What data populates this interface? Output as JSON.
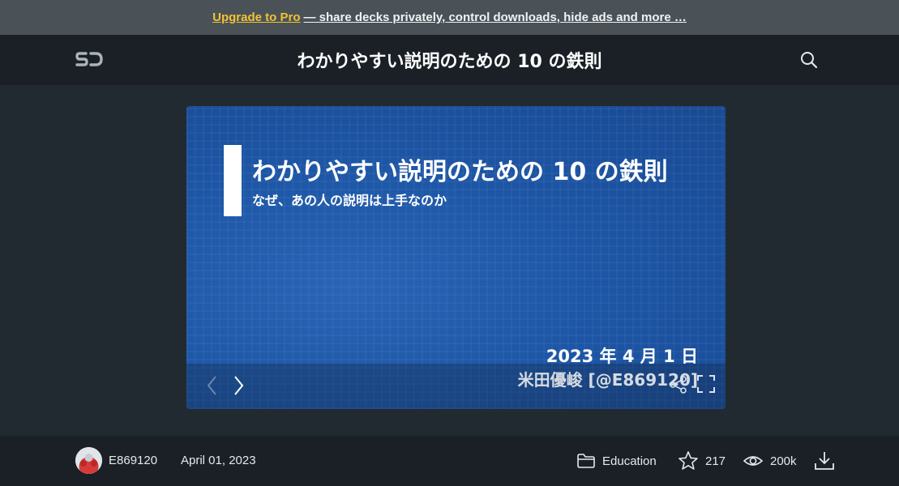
{
  "promo": {
    "link_label": "Upgrade to Pro",
    "text": "— share decks privately, control downloads, hide ads and more …"
  },
  "header": {
    "logo_text": "SD",
    "title": "わかりやすい説明のための 10 の鉄則",
    "search_icon": "search-icon"
  },
  "slide": {
    "title": "わかりやすい説明のための 10 の鉄則",
    "subtitle": "なぜ、あの人の説明は上手なのか",
    "date": "2023 年 4 月 1 日",
    "author": "米田優峻 [@E869120]",
    "controls": {
      "prev_icon": "chevron-left-icon",
      "next_icon": "chevron-right-icon",
      "share_icon": "share-icon",
      "fullscreen_icon": "fullscreen-icon"
    }
  },
  "footer": {
    "username": "E869120",
    "date": "April 01, 2023",
    "category": "Education",
    "stars": "217",
    "views": "200k",
    "icons": [
      "folder-icon",
      "star-icon",
      "eye-icon",
      "download-icon"
    ]
  },
  "colors": {
    "promo_bg": "#4a5258",
    "promo_link": "#f1c232",
    "header_bg": "#1a2026",
    "stage_bg": "#222a31",
    "slide_blue": "#1e58a8"
  }
}
